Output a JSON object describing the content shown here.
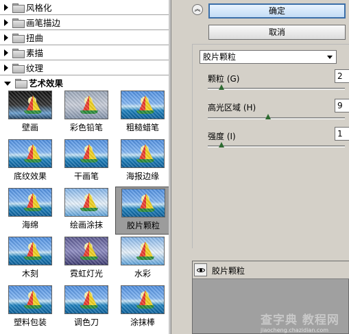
{
  "categories": [
    {
      "label": "风格化",
      "expanded": false
    },
    {
      "label": "画笔描边",
      "expanded": false
    },
    {
      "label": "扭曲",
      "expanded": false
    },
    {
      "label": "素描",
      "expanded": false
    },
    {
      "label": "纹理",
      "expanded": false
    },
    {
      "label": "艺术效果",
      "expanded": true
    }
  ],
  "thumbnails": [
    {
      "label": "壁画",
      "style": "dark"
    },
    {
      "label": "彩色铅笔",
      "style": "gray"
    },
    {
      "label": "粗糙蜡笔",
      "style": "normal"
    },
    {
      "label": "底纹效果",
      "style": "normal"
    },
    {
      "label": "干画笔",
      "style": "normal"
    },
    {
      "label": "海报边缘",
      "style": "normal"
    },
    {
      "label": "海绵",
      "style": "normal"
    },
    {
      "label": "绘画涂抹",
      "style": "pale"
    },
    {
      "label": "胶片颗粒",
      "style": "normal",
      "selected": true
    },
    {
      "label": "木刻",
      "style": "normal"
    },
    {
      "label": "霓虹灯光",
      "style": "purple"
    },
    {
      "label": "水彩",
      "style": "pale"
    },
    {
      "label": "塑料包装",
      "style": "normal"
    },
    {
      "label": "调色刀",
      "style": "normal"
    },
    {
      "label": "涂抹棒",
      "style": "normal"
    }
  ],
  "buttons": {
    "ok": "确定",
    "cancel": "取消"
  },
  "filter_select": "胶片颗粒",
  "params": [
    {
      "label": "颗粒 (G)",
      "value": "2",
      "level": 0.1
    },
    {
      "label": "高光区域 (H)",
      "value": "9",
      "level": 0.45
    },
    {
      "label": "强度 (I)",
      "value": "1",
      "level": 0.1
    }
  ],
  "layer": {
    "label": "胶片颗粒"
  },
  "watermark": {
    "big": "查字典 教程网",
    "small": "jiaocheng.chazidian.com"
  },
  "colors": {
    "selected_bg": "#9c9c9c",
    "panel_bg": "#d4d0c8",
    "default_btn": "#3a6ea8"
  }
}
